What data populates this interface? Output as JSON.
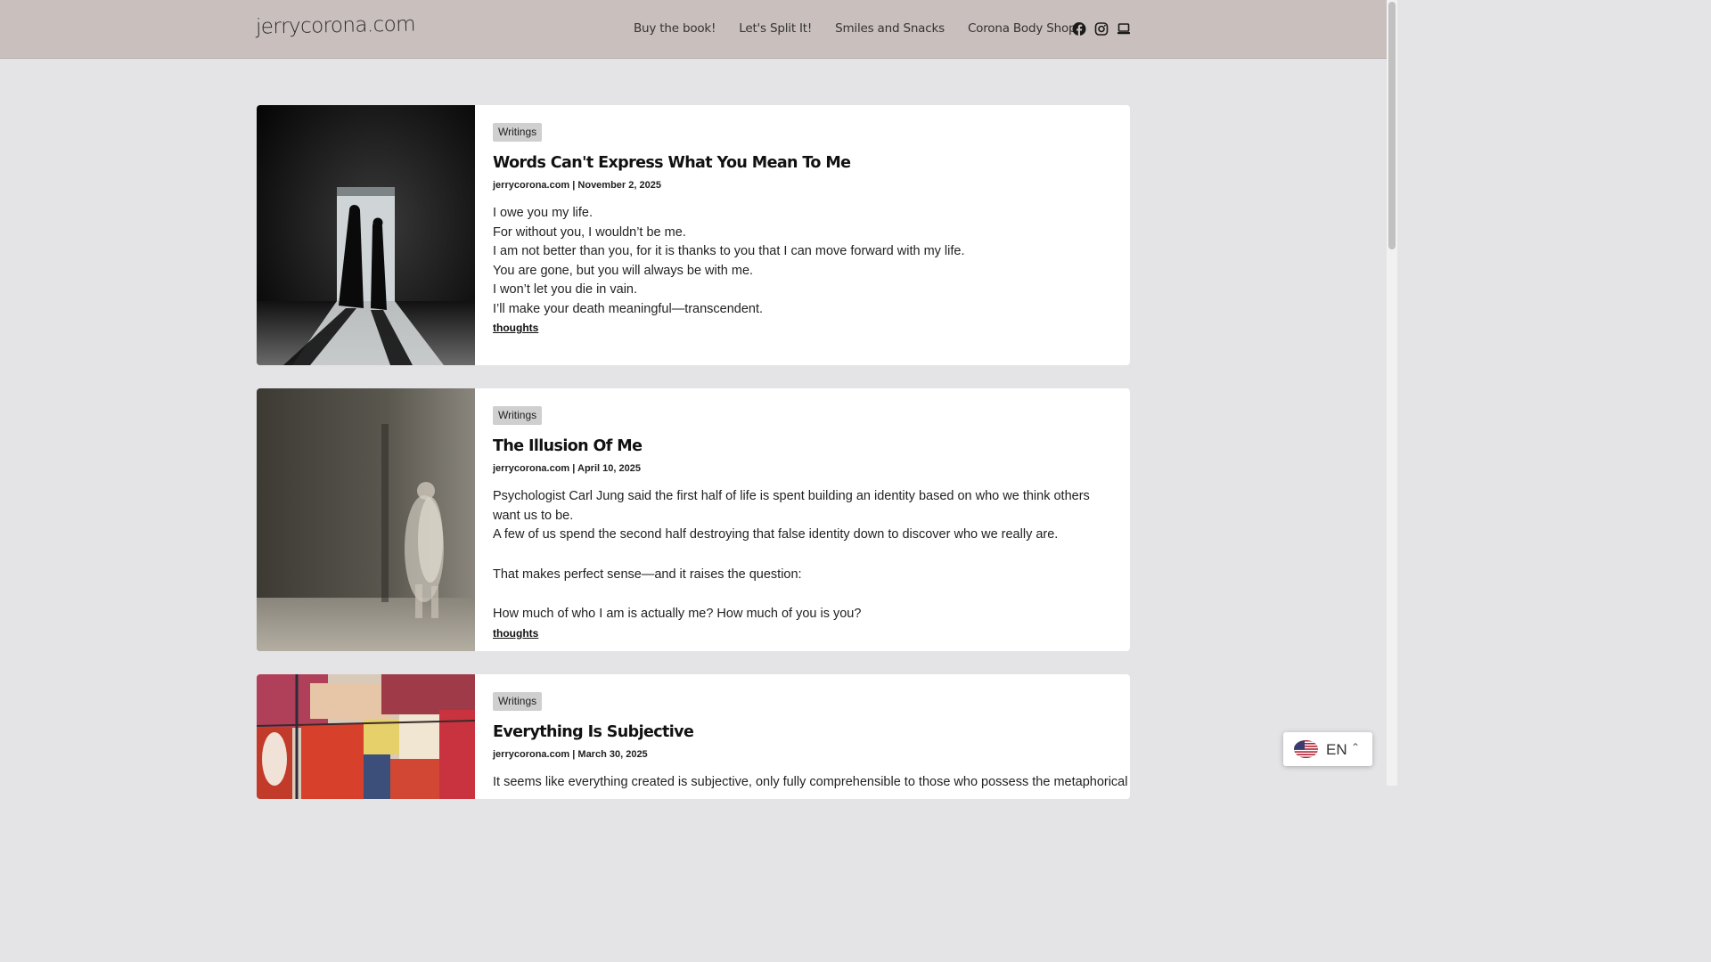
{
  "site": {
    "logo": "jerrycorona.com"
  },
  "nav": {
    "items": [
      {
        "label": "Buy the book!"
      },
      {
        "label": "Let's Split It!"
      },
      {
        "label": "Smiles and Snacks"
      },
      {
        "label": "Corona Body Shop"
      }
    ],
    "social": [
      "facebook-icon",
      "instagram-icon",
      "laptop-icon"
    ]
  },
  "posts": [
    {
      "category": "Writings",
      "title": "Words Can't Express What You Mean To Me",
      "author": "jerrycorona.com",
      "date": "November 2, 2025",
      "lines": [
        "I owe you my life.",
        "For without you, I wouldn’t be me.",
        "I am not better than you, for it is thanks to you that I can move forward with my life.",
        "You are gone, but you will always be with me.",
        "I won’t let you die in vain.",
        "I’ll make your death meaningful—transcendent."
      ],
      "tag": "thoughts"
    },
    {
      "category": "Writings",
      "title": "The Illusion Of Me",
      "author": "jerrycorona.com",
      "date": "April 10, 2025",
      "lines": [
        "Psychologist Carl Jung said the first half of life is spent building an identity based on who we think others want us to be.",
        "A few of us spend the second half destroying that false identity down to discover who we really are.",
        "",
        "That makes perfect sense—and it raises the question:",
        "",
        "How much of who I am is actually me? How much of you is you?"
      ],
      "tag": "thoughts"
    },
    {
      "category": "Writings",
      "title": "Everything Is Subjective",
      "author": "jerrycorona.com",
      "date": "March 30, 2025",
      "lines": [
        "It seems like everything created is subjective, only fully comprehensible to those who possess the metaphorical key to"
      ],
      "tag": ""
    }
  ],
  "language": {
    "code": "EN"
  },
  "colors": {
    "header": "#c9bfbd",
    "background": "#e4e4e7",
    "badge": "#cfcfcf"
  }
}
